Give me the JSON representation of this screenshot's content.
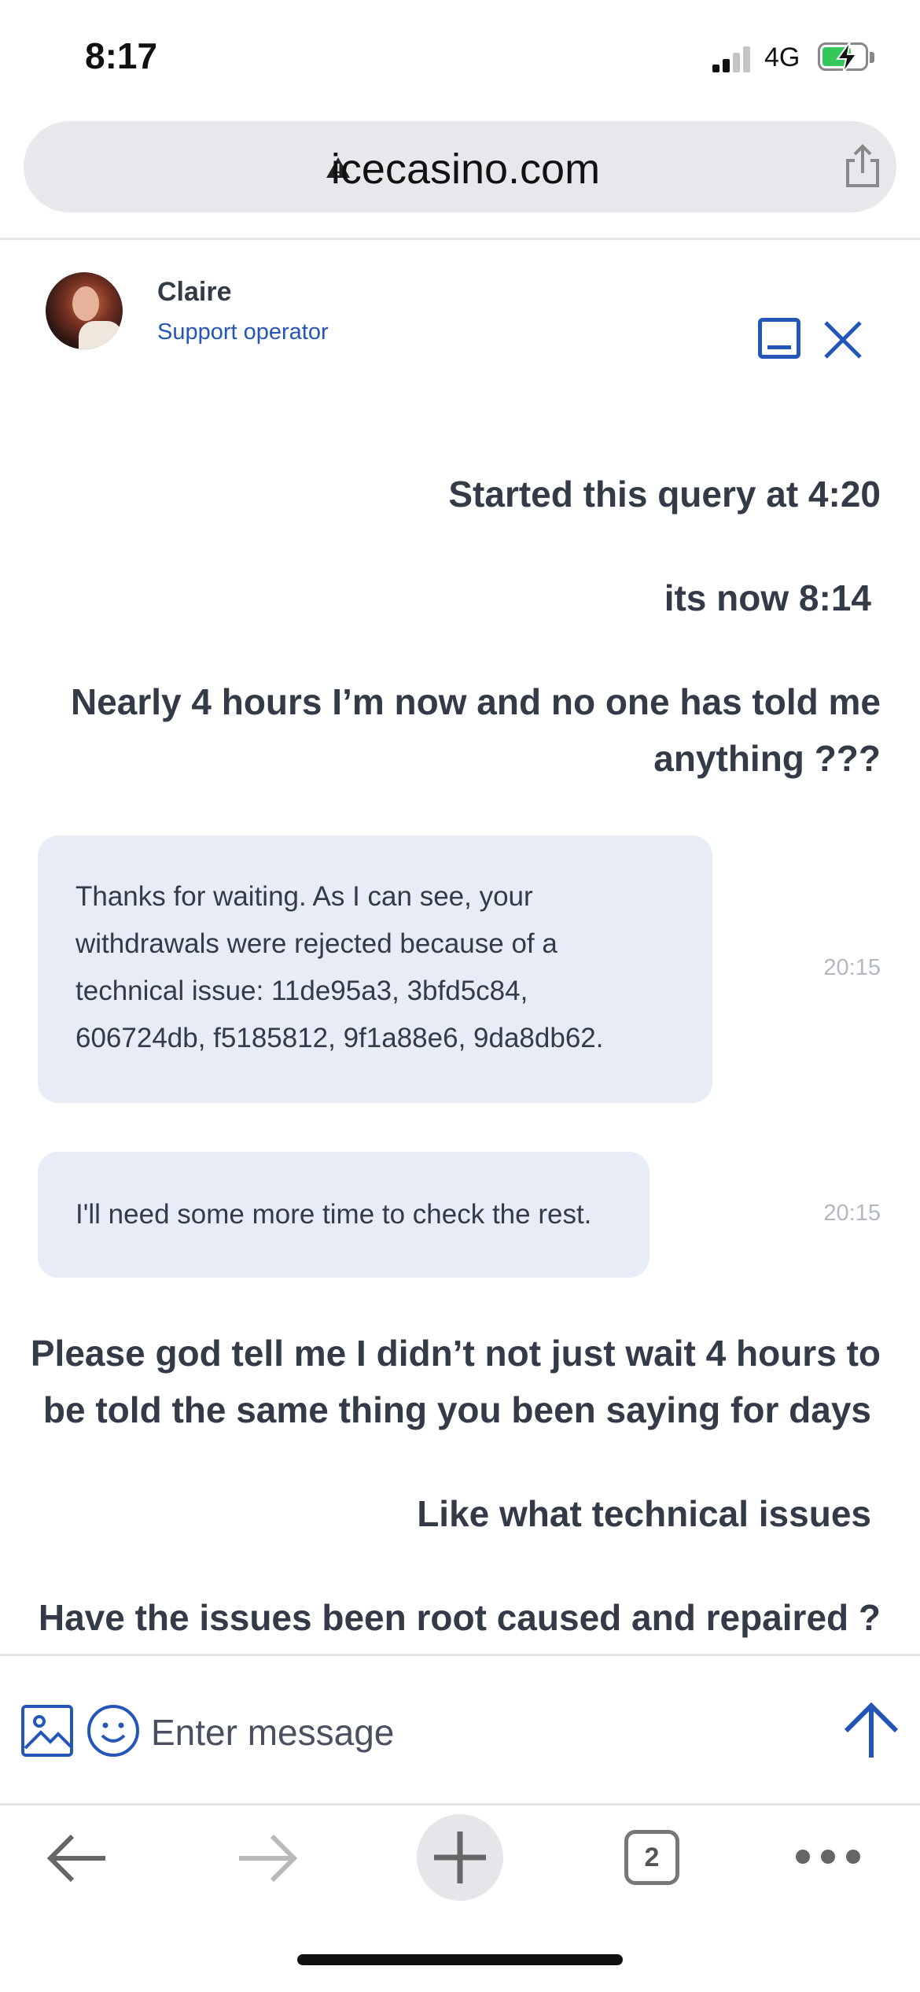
{
  "status_bar": {
    "time": "8:17",
    "network": "4G"
  },
  "browser": {
    "url": "icecasino.com"
  },
  "chat_header": {
    "agent_name": "Claire",
    "agent_role": "Support operator"
  },
  "messages": [
    {
      "type": "user",
      "text": "Started this query at 4:20"
    },
    {
      "type": "user",
      "text": "its now 8:14"
    },
    {
      "type": "user",
      "lines": [
        "Nearly 4 hours I’m now and no one has told me",
        "anything ???"
      ]
    },
    {
      "type": "operator",
      "lines": [
        "Thanks for waiting. As I can see, your",
        "withdrawals were rejected because of a",
        "technical issue: 11de95a3, 3bfd5c84,",
        "606724db, f5185812, 9f1a88e6, 9da8db62."
      ],
      "time": "20:15"
    },
    {
      "type": "operator",
      "lines": [
        "I'll need some more time to check the rest."
      ],
      "time": "20:15"
    },
    {
      "type": "user",
      "lines": [
        "Please god tell me I didn’t not just wait 4 hours to",
        "be told the same thing you been saying for days"
      ]
    },
    {
      "type": "user",
      "text": "Like what technical issues"
    },
    {
      "type": "user",
      "text": "Have the issues been root caused and repaired ?"
    }
  ],
  "composer": {
    "placeholder": "Enter message"
  },
  "toolbar": {
    "tab_count": "2"
  },
  "colors": {
    "accent": "#2356b8",
    "bubble": "#e7ecf6",
    "text": "#333a48"
  }
}
